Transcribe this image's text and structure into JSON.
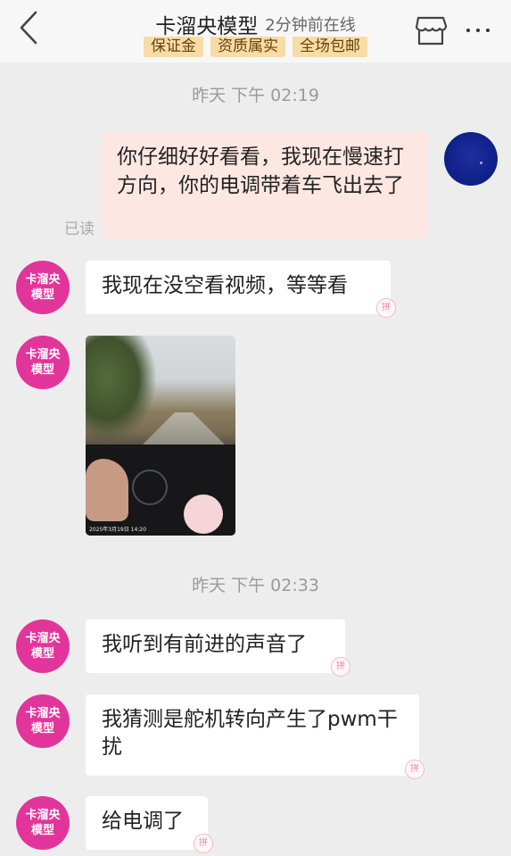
{
  "header": {
    "shop_name": "卡溜央模型",
    "online_status": "2分钟前在线",
    "badges": [
      "保证金",
      "资质属实",
      "全场包邮"
    ]
  },
  "messages": {
    "time1": "昨天 下午 02:19",
    "self_msg": "你仔细好好看看，我现在慢速打方向，你的电调带着车飞出去了",
    "read_label": "已读",
    "shop_avatar_text": "卡溜央模型",
    "msg1": "我现在没空看视频，等等看",
    "video_stamp": "2025年3月19日 14:20",
    "time2": "昨天 下午 02:33",
    "msg2": "我听到有前进的声音了",
    "msg3": "我猜测是舵机转向产生了pwm干扰",
    "msg4": "给电调了",
    "bubble_mark": "拼"
  }
}
